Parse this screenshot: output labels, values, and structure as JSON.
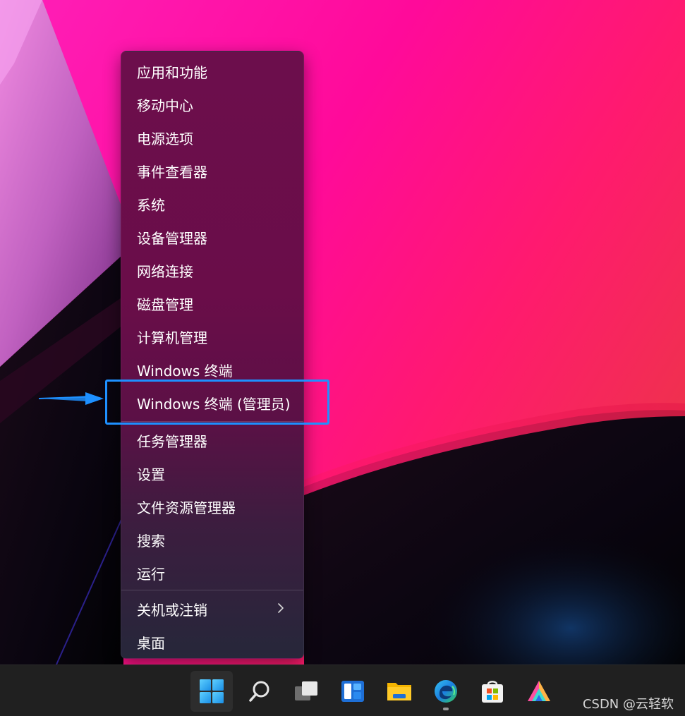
{
  "context_menu": {
    "items": [
      {
        "label": "应用和功能"
      },
      {
        "label": "移动中心"
      },
      {
        "label": "电源选项"
      },
      {
        "label": "事件查看器"
      },
      {
        "label": "系统"
      },
      {
        "label": "设备管理器"
      },
      {
        "label": "网络连接"
      },
      {
        "label": "磁盘管理"
      },
      {
        "label": "计算机管理"
      },
      {
        "label": "Windows 终端"
      },
      {
        "label": "Windows 终端 (管理员)"
      },
      {
        "label": "任务管理器"
      },
      {
        "label": "设置"
      },
      {
        "label": "文件资源管理器"
      },
      {
        "label": "搜索"
      },
      {
        "label": "运行"
      },
      {
        "label": "关机或注销",
        "has_submenu": true
      },
      {
        "label": "桌面"
      }
    ]
  },
  "annotation": {
    "highlight_color": "#1e90ff",
    "highlighted_item": "Windows 终端 (管理员)"
  },
  "taskbar": {
    "icons": [
      "start-icon",
      "search-icon",
      "task-view-icon",
      "widgets-icon",
      "file-explorer-icon",
      "edge-icon",
      "microsoft-store-icon",
      "app-icon"
    ],
    "watermark": "CSDN @云轻软"
  },
  "colors": {
    "menu_bg": "#6c0e4c",
    "taskbar_bg": "#202020",
    "accent": "#1e90ff"
  }
}
